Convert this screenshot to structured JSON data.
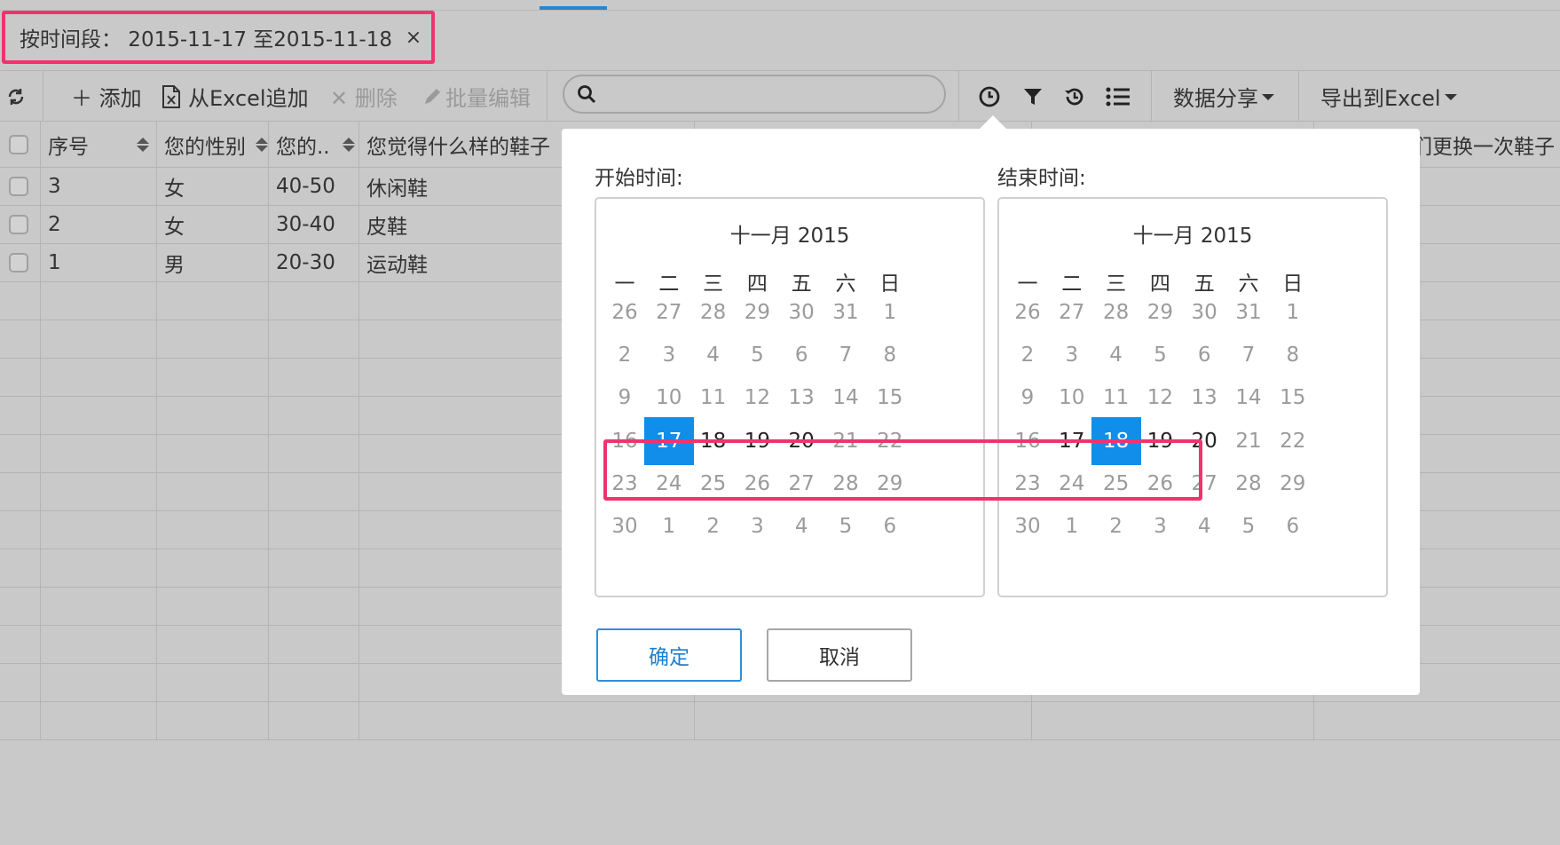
{
  "filter": {
    "label": "按时间段：  2015-11-17 至2015-11-18",
    "close_glyph": "×"
  },
  "toolbar": {
    "refresh_glyph": "↻",
    "add_label": "＋ 添加",
    "excel_append_label": "从Excel追加",
    "delete_label": "✕ 删除",
    "batch_edit_label": "批量编辑",
    "search_placeholder": "",
    "share_label": "数据分享",
    "export_label": "导出到Excel"
  },
  "table": {
    "headers": [
      "序号",
      "您的性别",
      "您的..",
      "您觉得什么样的鞋子",
      "",
      "",
      "们更换一次鞋子"
    ],
    "rows": [
      [
        "3",
        "女",
        "40-50",
        "休闲鞋"
      ],
      [
        "2",
        "女",
        "30-40",
        "皮鞋"
      ],
      [
        "1",
        "男",
        "20-30",
        "运动鞋"
      ]
    ]
  },
  "datepicker": {
    "start_label": "开始时间:",
    "end_label": "结束时间:",
    "start_title": "十一月 2015",
    "end_title": "十一月 2015",
    "weekdays": [
      "一",
      "二",
      "三",
      "四",
      "五",
      "六",
      "日"
    ],
    "start_days": [
      [
        "26",
        "27",
        "28",
        "29",
        "30",
        "31",
        "1"
      ],
      [
        "2",
        "3",
        "4",
        "5",
        "6",
        "7",
        "8"
      ],
      [
        "9",
        "10",
        "11",
        "12",
        "13",
        "14",
        "15"
      ],
      [
        "16",
        "17",
        "18",
        "19",
        "20",
        "21",
        "22"
      ],
      [
        "23",
        "24",
        "25",
        "26",
        "27",
        "28",
        "29"
      ],
      [
        "30",
        "1",
        "2",
        "3",
        "4",
        "5",
        "6"
      ]
    ],
    "end_days": [
      [
        "26",
        "27",
        "28",
        "29",
        "30",
        "31",
        "1"
      ],
      [
        "2",
        "3",
        "4",
        "5",
        "6",
        "7",
        "8"
      ],
      [
        "9",
        "10",
        "11",
        "12",
        "13",
        "14",
        "15"
      ],
      [
        "16",
        "17",
        "18",
        "19",
        "20",
        "21",
        "22"
      ],
      [
        "23",
        "24",
        "25",
        "26",
        "27",
        "28",
        "29"
      ],
      [
        "30",
        "1",
        "2",
        "3",
        "4",
        "5",
        "6"
      ]
    ],
    "start_selected": "17",
    "end_selected": "18",
    "start_enabled": [
      "17",
      "18",
      "19",
      "20"
    ],
    "end_enabled": [
      "17",
      "18",
      "19",
      "20"
    ],
    "ok_label": "确定",
    "cancel_label": "取消"
  },
  "colors": {
    "highlight": "#f0336f",
    "selected": "#108ee9"
  }
}
